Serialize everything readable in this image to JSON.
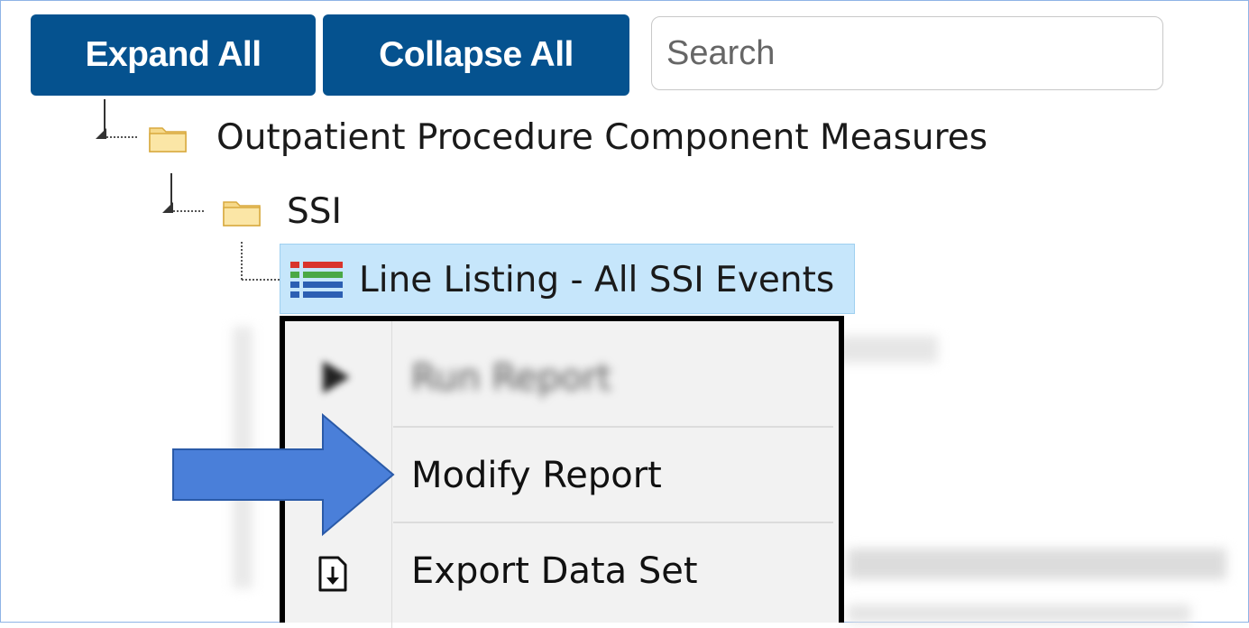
{
  "toolbar": {
    "expand_label": "Expand All",
    "collapse_label": "Collapse All",
    "search_placeholder": "Search"
  },
  "tree": {
    "root_label": "Outpatient Procedure Component Measures",
    "child_label": "SSI",
    "selected_label": "Line Listing - All SSI Events"
  },
  "context_menu": {
    "items": [
      {
        "label": "Run Report",
        "icon": "play-icon",
        "blurred": true
      },
      {
        "label": "Modify Report",
        "icon": "none"
      },
      {
        "label": "Export Data Set",
        "icon": "export-icon"
      }
    ]
  },
  "colors": {
    "button_bg": "#05528f",
    "selection_bg": "#c6e6fb",
    "arrow": "#4a7fd9"
  }
}
